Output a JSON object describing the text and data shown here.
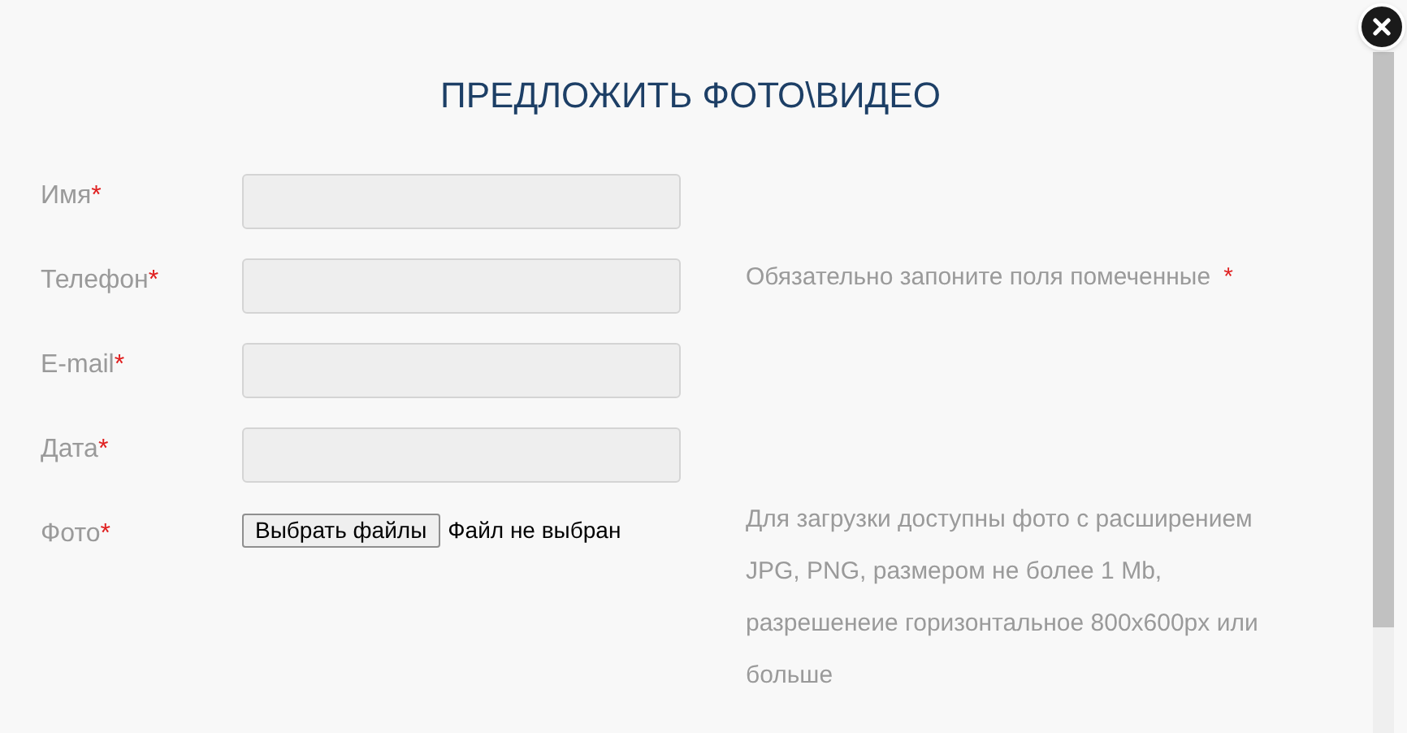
{
  "dialog": {
    "title": "ПРЕДЛОЖИТЬ ФОТО\\ВИДЕО"
  },
  "fields": [
    {
      "kind": "text",
      "label": "Имя",
      "required_mark": "*"
    },
    {
      "kind": "text",
      "label": "Телефон",
      "required_mark": "*"
    },
    {
      "kind": "text",
      "label": "E-mail",
      "required_mark": "*"
    },
    {
      "kind": "text",
      "label": "Дата",
      "required_mark": "*"
    },
    {
      "kind": "file",
      "label": "Фото",
      "required_mark": "*",
      "button": "Выбрать файлы",
      "status": "Файл не выбран"
    }
  ],
  "notes": [
    {
      "text": "Обязательно запоните поля помеченные",
      "required_mark": "*"
    },
    {
      "text": "Для загрузки доступны фото с расширением JPG, PNG, размером не более 1 Mb, разрешенеие горизонтальное 800x600px или больше"
    }
  ]
}
